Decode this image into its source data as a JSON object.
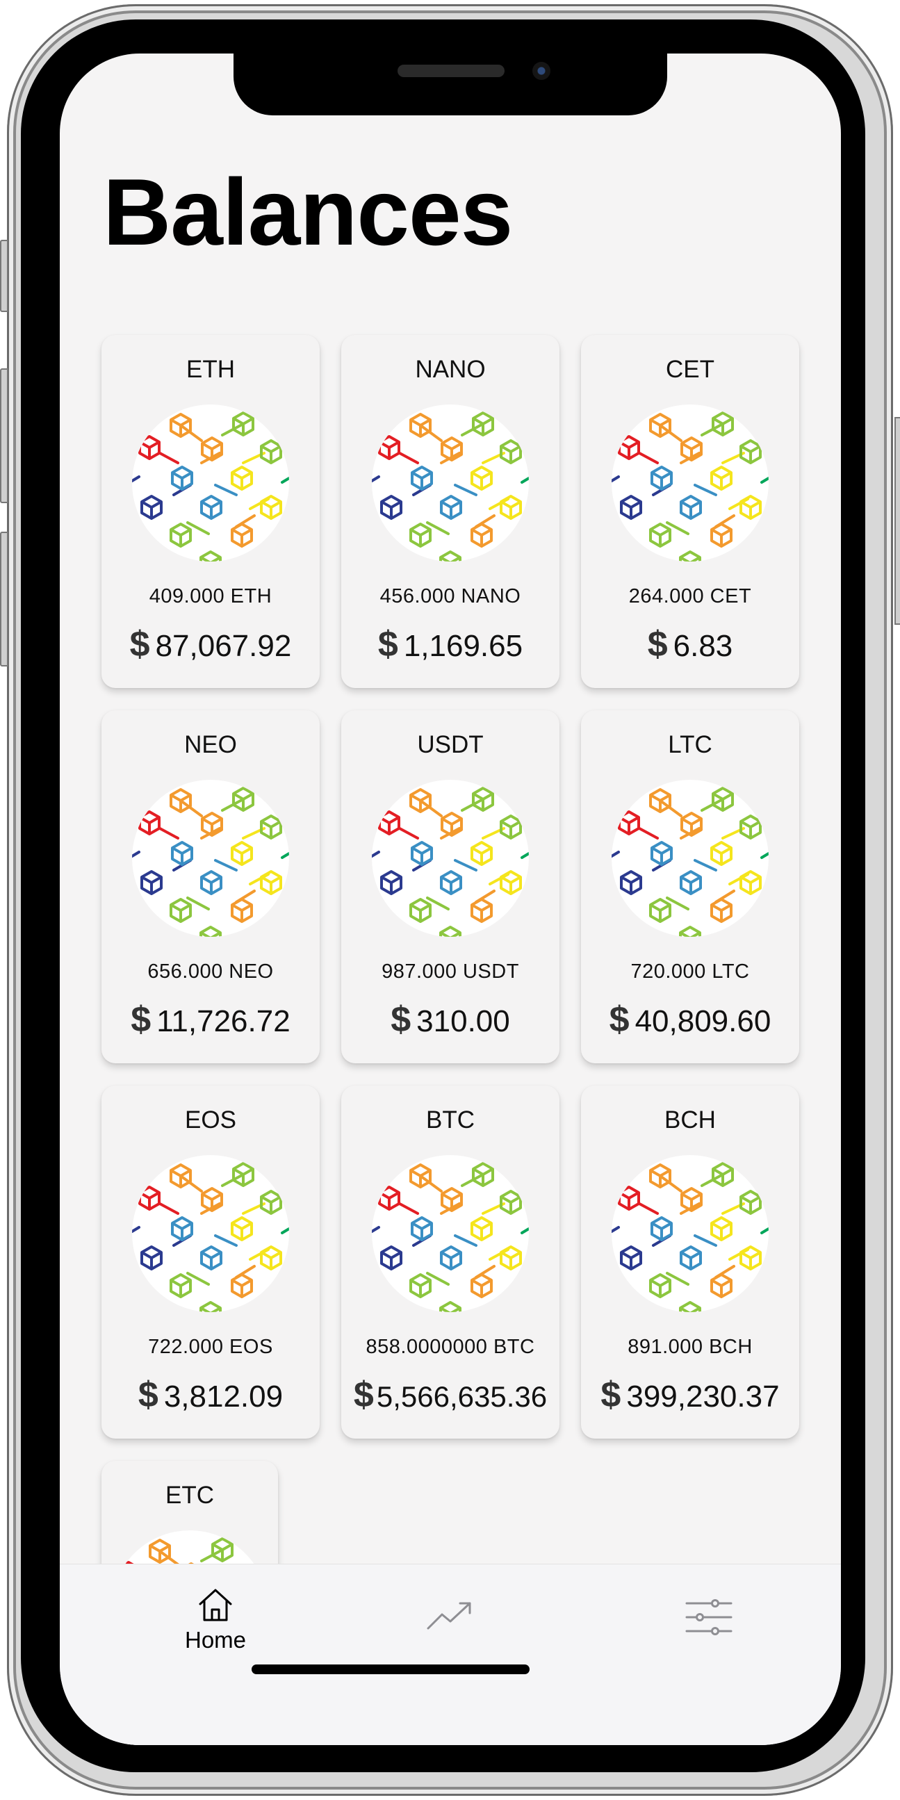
{
  "page": {
    "title": "Balances"
  },
  "balances": [
    {
      "symbol": "ETH",
      "amount": "409.000 ETH",
      "usd_symbol": "$",
      "usd": "87,067.92"
    },
    {
      "symbol": "NANO",
      "amount": "456.000 NANO",
      "usd_symbol": "$",
      "usd": "1,169.65"
    },
    {
      "symbol": "CET",
      "amount": "264.000 CET",
      "usd_symbol": "$",
      "usd": "6.83"
    },
    {
      "symbol": "NEO",
      "amount": "656.000 NEO",
      "usd_symbol": "$",
      "usd": "11,726.72"
    },
    {
      "symbol": "USDT",
      "amount": "987.000 USDT",
      "usd_symbol": "$",
      "usd": "310.00"
    },
    {
      "symbol": "LTC",
      "amount": "720.000 LTC",
      "usd_symbol": "$",
      "usd": "40,809.60"
    },
    {
      "symbol": "EOS",
      "amount": "722.000 EOS",
      "usd_symbol": "$",
      "usd": "3,812.09"
    },
    {
      "symbol": "BTC",
      "amount": "858.0000000 BTC",
      "usd_symbol": "$",
      "usd": "5,566,635.36"
    },
    {
      "symbol": "BCH",
      "amount": "891.000 BCH",
      "usd_symbol": "$",
      "usd": "399,230.37"
    },
    {
      "symbol": "ETC",
      "amount": "",
      "usd_symbol": "",
      "usd": ""
    }
  ],
  "tabbar": {
    "items": [
      {
        "label": "Home",
        "icon": "home-icon",
        "active": true
      },
      {
        "label": "",
        "icon": "trending-up-icon",
        "active": false
      },
      {
        "label": "",
        "icon": "sliders-icon",
        "active": false
      }
    ]
  },
  "colors": {
    "background": "#f5f4f4",
    "card": "#f4f3f3",
    "text": "#111111"
  }
}
